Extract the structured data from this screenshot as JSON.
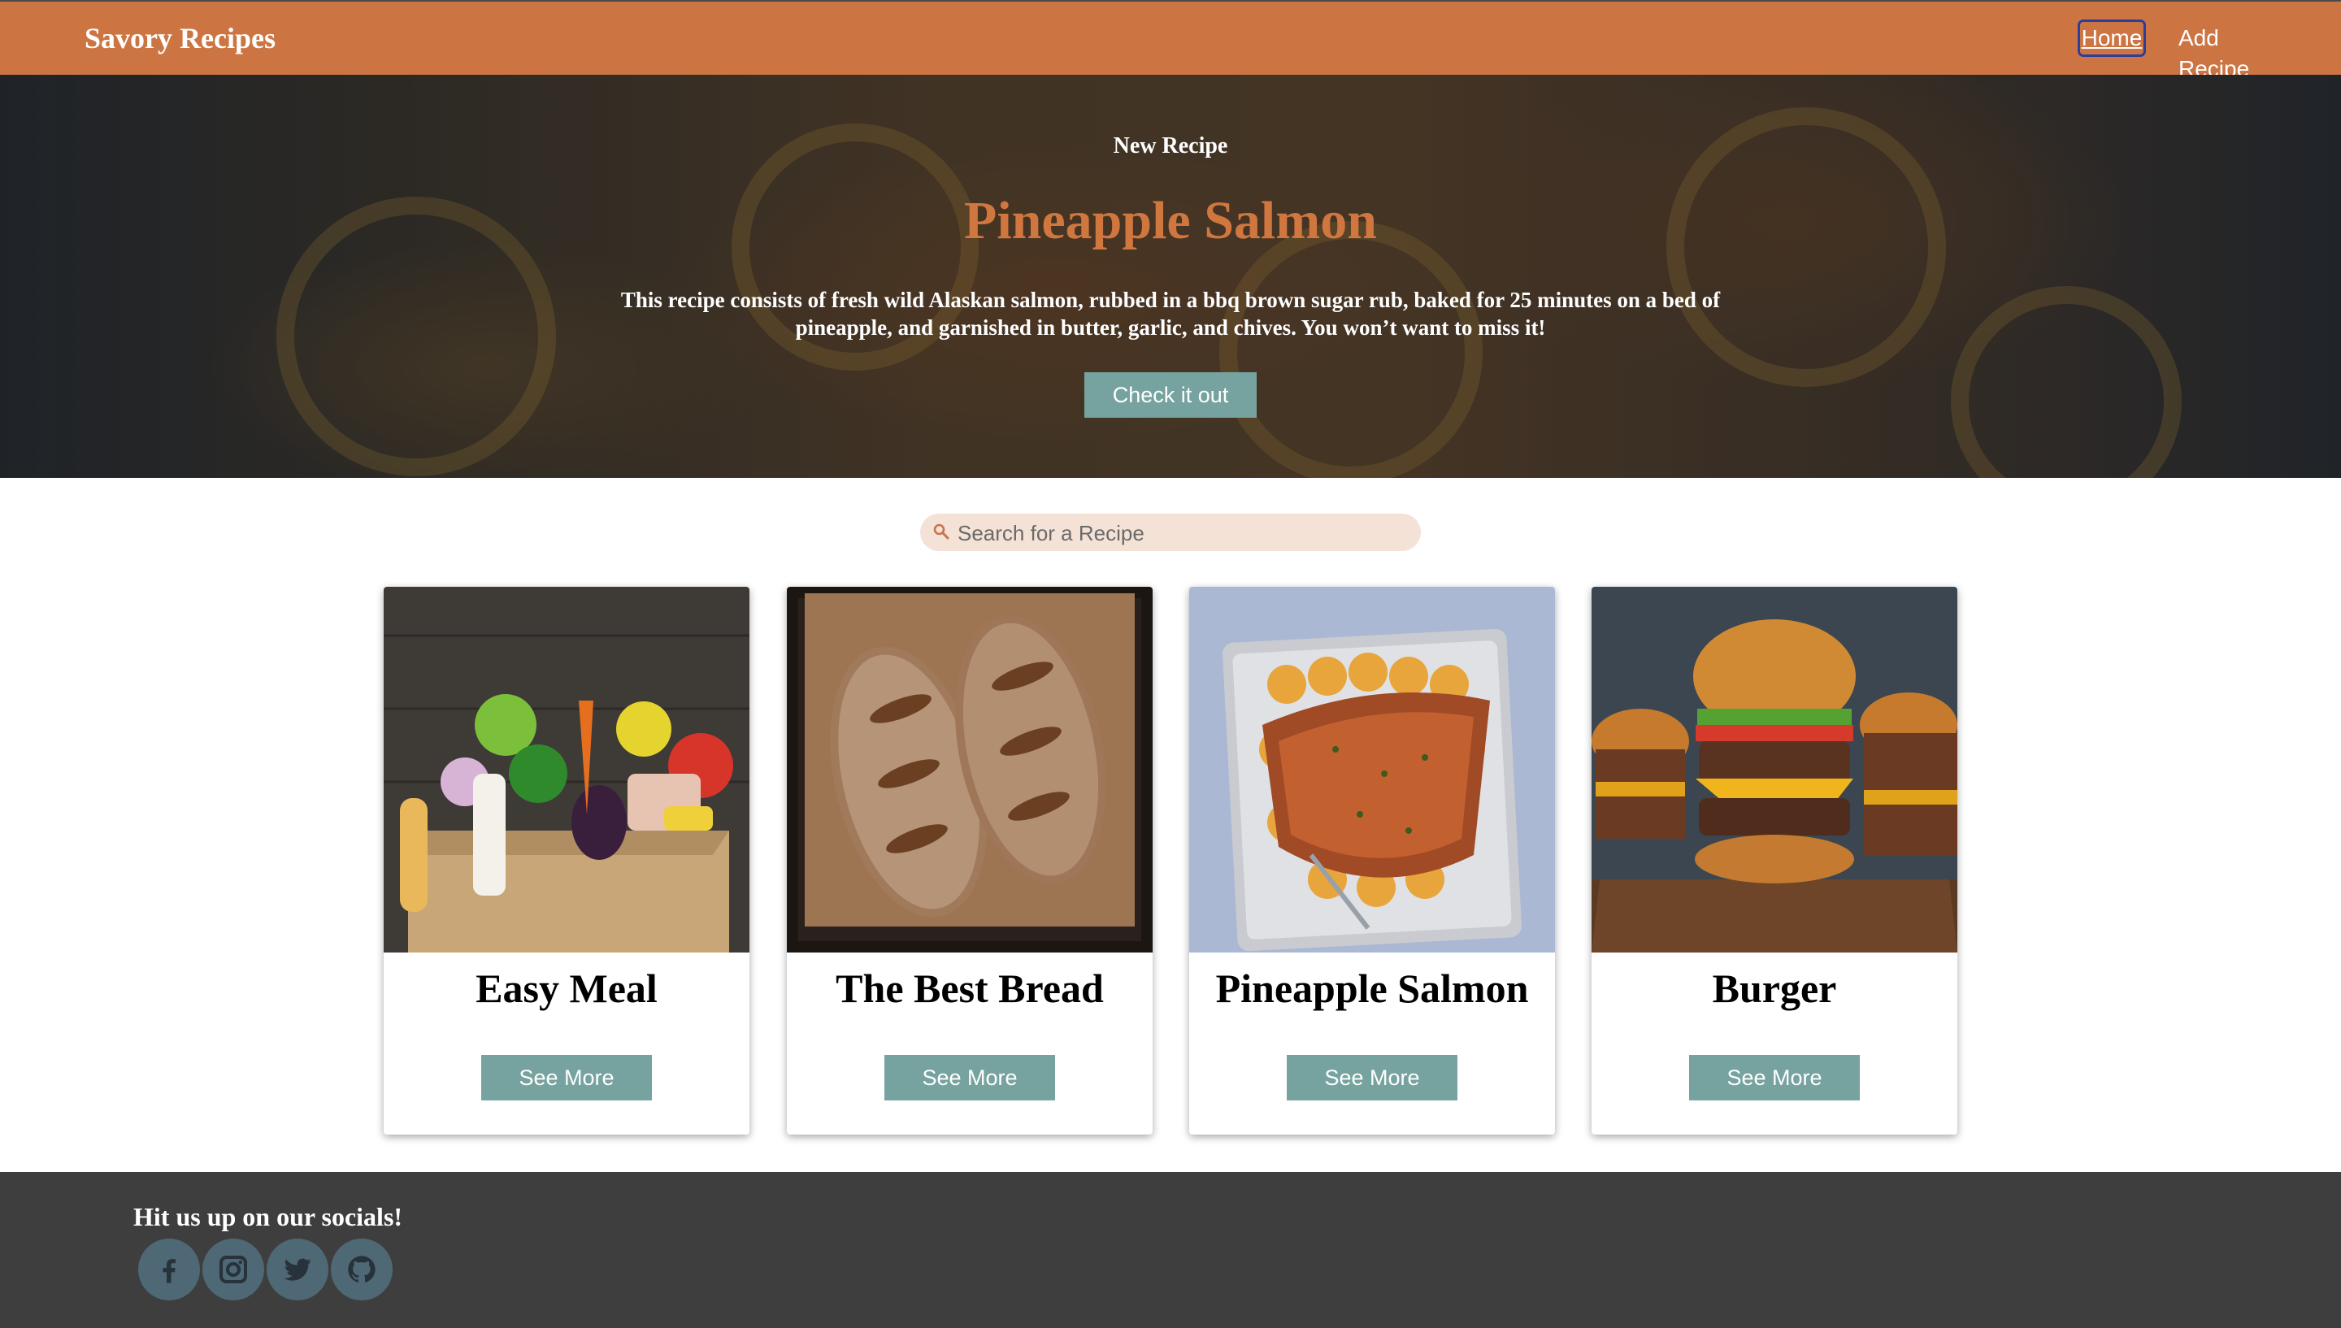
{
  "header": {
    "brand": "Savory Recipes",
    "nav": {
      "home": "Home",
      "add_recipe": "Add Recipe"
    }
  },
  "hero": {
    "kicker": "New Recipe",
    "title": "Pineapple Salmon",
    "description": "This recipe consists of fresh wild Alaskan salmon, rubbed in a bbq brown sugar rub, baked for 25 minutes on a bed of pineapple, and garnished in butter, garlic, and chives. You won’t want to miss it!",
    "button": "Check it out"
  },
  "search": {
    "placeholder": "Search for a Recipe",
    "icon": "search-icon"
  },
  "cards": [
    {
      "title": "Easy Meal",
      "button": "See More",
      "image": "grocery-bag-image"
    },
    {
      "title": "The Best Bread",
      "button": "See More",
      "image": "bread-loaves-image"
    },
    {
      "title": "Pineapple Salmon",
      "button": "See More",
      "image": "salmon-tray-image"
    },
    {
      "title": "Burger",
      "button": "See More",
      "image": "burgers-image"
    }
  ],
  "footer": {
    "title": "Hit us up on our socials!",
    "socials": [
      "facebook-icon",
      "instagram-icon",
      "twitter-icon",
      "github-icon"
    ]
  },
  "colors": {
    "header_bg": "#cc7543",
    "accent_title": "#d0763f",
    "button_bg": "#76a39f",
    "search_bg": "#f5e2d7",
    "footer_bg": "#3e3e3e",
    "social_bg": "#4e6876"
  }
}
